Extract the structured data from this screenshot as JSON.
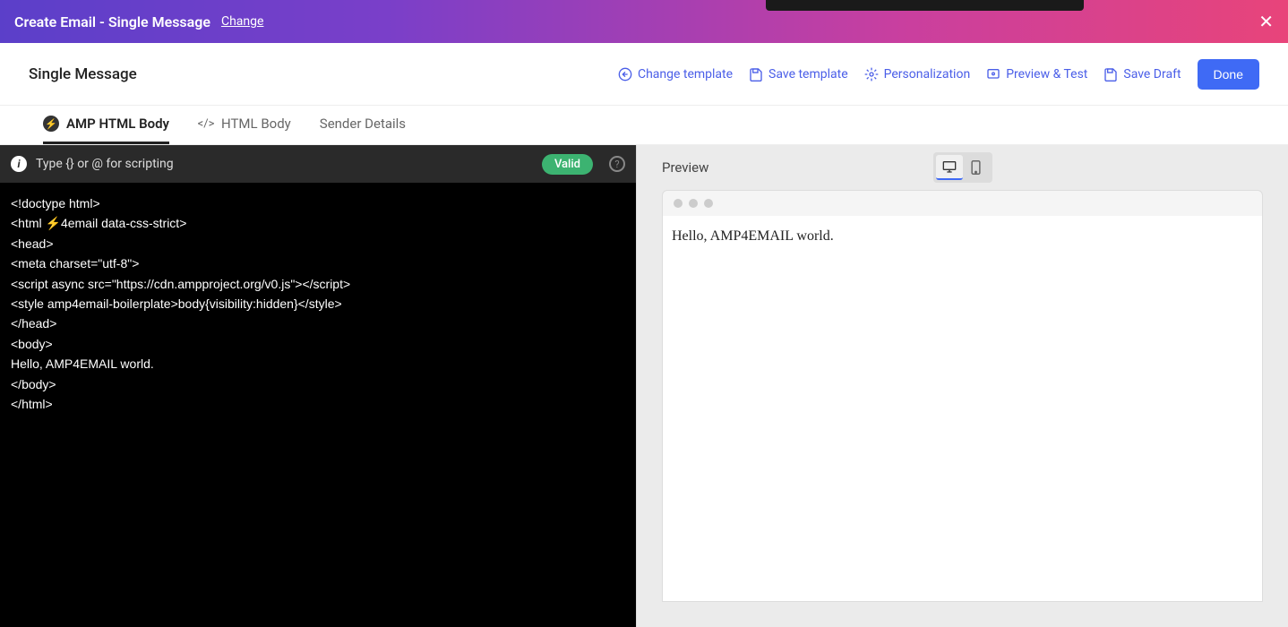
{
  "header": {
    "title": "Create Email - Single Message",
    "change_label": "Change"
  },
  "toolbar": {
    "title": "Single Message",
    "change_template": "Change template",
    "save_template": "Save template",
    "personalization": "Personalization",
    "preview_test": "Preview & Test",
    "save_draft": "Save Draft",
    "done": "Done"
  },
  "tabs": {
    "amp_html_body": "AMP HTML Body",
    "html_body": "HTML Body",
    "sender_details": "Sender Details"
  },
  "editor": {
    "hint": "Type {} or @ for scripting",
    "valid_badge": "Valid",
    "code": "<!doctype html>\n<html ⚡4email data-css-strict>\n<head>\n<meta charset=\"utf-8\">\n<script async src=\"https://cdn.ampproject.org/v0.js\"></script>\n<style amp4email-boilerplate>body{visibility:hidden}</style>\n</head>\n<body>\nHello, AMP4EMAIL world.\n</body>\n</html>"
  },
  "preview": {
    "title": "Preview",
    "content": "Hello, AMP4EMAIL world."
  },
  "colors": {
    "primary": "#3f6af5",
    "link": "#4a5ee8",
    "valid": "#3cb371"
  }
}
